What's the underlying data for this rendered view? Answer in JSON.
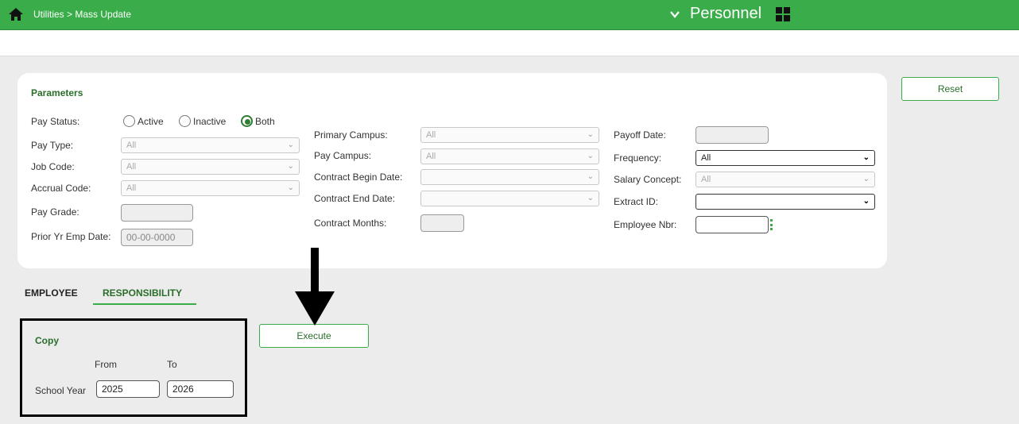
{
  "header": {
    "breadcrumb": "Utilities > Mass Update",
    "module": "Personnel",
    "icons": {
      "home": "home-icon",
      "chevron": "chevron-down-icon",
      "apps": "apps-grid-icon"
    }
  },
  "parameters": {
    "title": "Parameters",
    "pay_status": {
      "label": "Pay Status:",
      "options": [
        "Active",
        "Inactive",
        "Both"
      ],
      "selected": "Both"
    },
    "pay_type": {
      "label": "Pay Type:",
      "value": "All"
    },
    "job_code": {
      "label": "Job Code:",
      "value": "All"
    },
    "accrual_code": {
      "label": "Accrual Code:",
      "value": "All"
    },
    "pay_grade": {
      "label": "Pay Grade:",
      "value": ""
    },
    "prior_yr_emp_date": {
      "label": "Prior Yr Emp Date:",
      "value": "00-00-0000"
    },
    "primary_campus": {
      "label": "Primary Campus:",
      "value": "All"
    },
    "pay_campus": {
      "label": "Pay Campus:",
      "value": "All"
    },
    "contract_begin_date": {
      "label": "Contract Begin Date:",
      "value": ""
    },
    "contract_end_date": {
      "label": "Contract End Date:",
      "value": ""
    },
    "contract_months": {
      "label": "Contract Months:",
      "value": ""
    },
    "payoff_date": {
      "label": "Payoff Date:",
      "value": ""
    },
    "frequency": {
      "label": "Frequency:",
      "value": "All"
    },
    "salary_concept": {
      "label": "Salary Concept:",
      "value": "All"
    },
    "extract_id": {
      "label": "Extract ID:",
      "value": ""
    },
    "employee_nbr": {
      "label": "Employee Nbr:",
      "value": ""
    }
  },
  "buttons": {
    "reset": "Reset",
    "execute": "Execute"
  },
  "tabs": [
    {
      "label": "EMPLOYEE",
      "selected": false
    },
    {
      "label": "RESPONSIBILITY",
      "selected": true
    }
  ],
  "copy": {
    "title": "Copy",
    "from_label": "From",
    "to_label": "To",
    "row_label": "School Year",
    "from_value": "2025",
    "to_value": "2026"
  },
  "colors": {
    "header_green": "#3aad4a",
    "accent_dark_green": "#2a6e2a",
    "highlight_box": "#000000"
  }
}
